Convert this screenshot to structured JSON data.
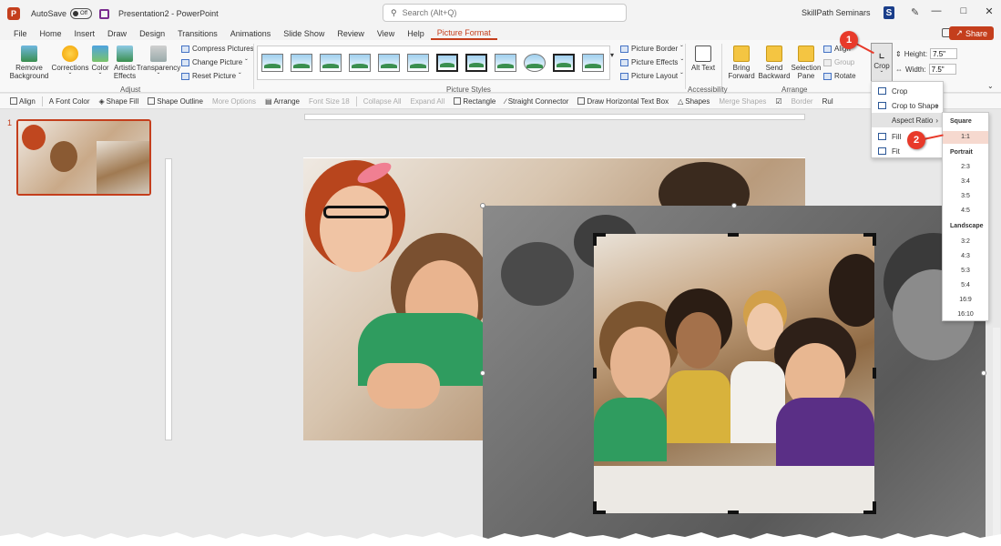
{
  "titlebar": {
    "autosave_label": "AutoSave",
    "autosave_state": "Off",
    "doc_title": "Presentation2 - PowerPoint",
    "search_placeholder": "Search (Alt+Q)",
    "user_name": "SkillPath Seminars",
    "user_initial": "S"
  },
  "menu": {
    "tabs": [
      "File",
      "Home",
      "Insert",
      "Draw",
      "Design",
      "Transitions",
      "Animations",
      "Slide Show",
      "Review",
      "View",
      "Help",
      "Picture Format"
    ],
    "active_tab": "Picture Format",
    "share_label": "Share"
  },
  "ribbon": {
    "adjust": {
      "remove_background": "Remove Background",
      "corrections": "Corrections",
      "color": "Color",
      "artistic_effects": "Artistic Effects",
      "transparency": "Transparency",
      "compress_pictures": "Compress Pictures",
      "change_picture": "Change Picture",
      "reset_picture": "Reset Picture",
      "group_label": "Adjust"
    },
    "picture_styles": {
      "picture_border": "Picture Border",
      "picture_effects": "Picture Effects",
      "picture_layout": "Picture Layout",
      "group_label": "Picture Styles"
    },
    "accessibility": {
      "alt_text": "Alt Text",
      "group_label": "Accessibility"
    },
    "arrange": {
      "bring_forward": "Bring Forward",
      "send_backward": "Send Backward",
      "selection_pane": "Selection Pane",
      "align": "Align",
      "group": "Group",
      "rotate": "Rotate",
      "group_label": "Arrange"
    },
    "size": {
      "crop": "Crop",
      "height_label": "Height:",
      "height_value": "7.5\"",
      "width_label": "Width:",
      "width_value": "7.5\""
    }
  },
  "quick_toolbar": {
    "align": "Align",
    "font_color": "Font Color",
    "shape_fill": "Shape Fill",
    "shape_outline": "Shape Outline",
    "more_options": "More Options",
    "arrange": "Arrange",
    "font_size_label": "Font Size",
    "font_size_value": "18",
    "collapse_all": "Collapse All",
    "expand_all": "Expand All",
    "rectangle": "Rectangle",
    "straight_connector": "Straight Connector",
    "draw_horizontal_text_box": "Draw Horizontal Text Box",
    "shapes": "Shapes",
    "merge_shapes": "Merge Shapes",
    "border": "Border",
    "ruler_partial": "Rul"
  },
  "slides_panel": {
    "slide_number": "1"
  },
  "crop_menu": {
    "items": [
      "Crop",
      "Crop to Shape",
      "Aspect Ratio",
      "Fill",
      "Fit"
    ]
  },
  "aspect_menu": {
    "square_header": "Square",
    "square_items": [
      "1:1"
    ],
    "portrait_header": "Portrait",
    "portrait_items": [
      "2:3",
      "3:4",
      "3:5",
      "4:5"
    ],
    "landscape_header": "Landscape",
    "landscape_items": [
      "3:2",
      "4:3",
      "5:3",
      "5:4",
      "16:9",
      "16:10"
    ]
  },
  "callouts": {
    "first": "1",
    "second": "2"
  },
  "colors": {
    "accent": "#c43e1c",
    "callout": "#e83a2a"
  }
}
